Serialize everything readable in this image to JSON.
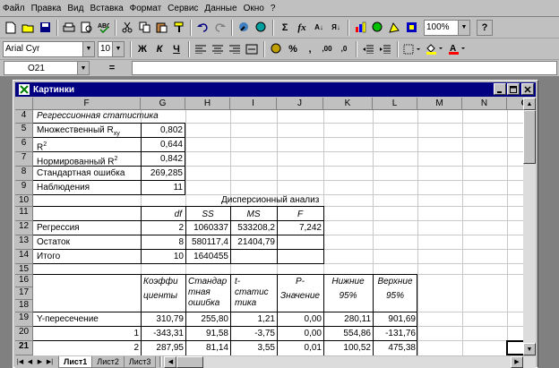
{
  "menu": {
    "items": [
      "Файл",
      "Правка",
      "Вид",
      "Вставка",
      "Формат",
      "Сервис",
      "Данные",
      "Окно",
      "?"
    ]
  },
  "toolbar": {
    "zoom": "100%",
    "autosum": "Σ",
    "fx": "fx",
    "sort_az": "А↓",
    "sort_za": "Я↓",
    "tools": [
      "new-icon",
      "open-icon",
      "save-icon",
      "print-icon",
      "preview-icon",
      "spell-icon",
      "cut-icon",
      "copy-icon",
      "paste-icon",
      "format-painter-icon",
      "undo-icon",
      "redo-icon",
      "hyperlink-icon",
      "web-icon",
      "chart-wizard-icon",
      "map-icon",
      "drawing-icon"
    ]
  },
  "format": {
    "font": "Arial Cyr",
    "size": "10",
    "bold": "Ж",
    "italic": "К",
    "underline": "Ч",
    "percent": "%",
    "thousands": ",",
    "inc_dec": ",00",
    "dec_dec": ",0",
    "currency": "$"
  },
  "formula": {
    "cell_ref": "O21",
    "equals": "="
  },
  "window": {
    "title": "Картинки"
  },
  "grid": {
    "columns": [
      "F",
      "G",
      "H",
      "I",
      "J",
      "K",
      "L",
      "M",
      "N",
      "O"
    ],
    "rows": [
      "4",
      "5",
      "6",
      "7",
      "8",
      "9",
      "10",
      "11",
      "12",
      "13",
      "14",
      "15",
      "16",
      "17",
      "18",
      "19",
      "20",
      "21"
    ],
    "regr_title": "Регрессионная статистика",
    "multiple_r": "Множественный R",
    "multiple_r_sub": "xy",
    "multiple_r_val": "0,802",
    "r2": "R",
    "r2_sup": "2",
    "r2_val": "0,644",
    "norm_r2": "Нормированный R",
    "norm_r2_sup": "2",
    "norm_r2_val": "0,842",
    "std_err": "Стандартная ошибка",
    "std_err_val": "269,285",
    "obs": "Наблюдения",
    "obs_val": "11",
    "anova": "Дисперсионный анализ",
    "df": "df",
    "ss": "SS",
    "ms": "MS",
    "f": "F",
    "reg": "Регрессия",
    "reg_df": "2",
    "reg_ss": "1060337",
    "reg_ms": "533208,2",
    "reg_f": "7,242",
    "rest": "Остаток",
    "rest_df": "8",
    "rest_ss": "580117,4",
    "rest_ms": "21404,79",
    "total": "Итого",
    "total_df": "10",
    "total_ss": "1640455",
    "h_coef": [
      "Коэффи",
      "циенты"
    ],
    "h_std": [
      "Стандар",
      "тная",
      "ошибка"
    ],
    "h_t": [
      "t-",
      "статис",
      "тика"
    ],
    "h_p": [
      "P-",
      "Значение"
    ],
    "h_low": [
      "Нижние",
      "95%"
    ],
    "h_up": [
      "Верхние",
      "95%"
    ],
    "y_int": "Y-пересечение",
    "y_vals": [
      "310,79",
      "255,80",
      "1,21",
      "0,00",
      "280,11",
      "901,69"
    ],
    "x1": "1",
    "x1_vals": [
      "-343,31",
      "91,58",
      "-3,75",
      "0,00",
      "554,86",
      "-131,76"
    ],
    "x2": "2",
    "x2_vals": [
      "287,95",
      "81,14",
      "3,55",
      "0,01",
      "100,52",
      "475,38"
    ]
  },
  "tabs": [
    "Лист1",
    "Лист2",
    "Лист3"
  ]
}
